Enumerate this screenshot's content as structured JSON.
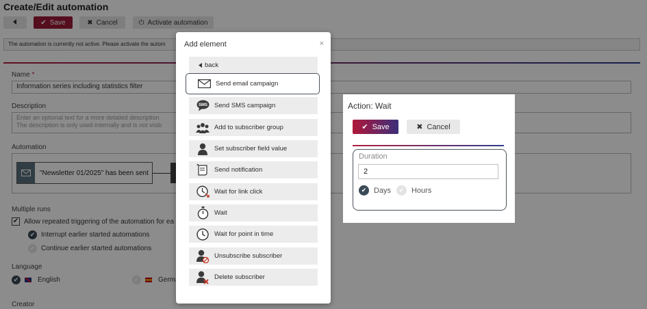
{
  "page": {
    "title": "Create/Edit automation",
    "toolbar": {
      "back_icon": "caret-left",
      "save_label": "Save",
      "cancel_label": "Cancel",
      "activate_label": "Activate automation"
    },
    "info_text": "The automation is currently not active. Please activate the autom",
    "name": {
      "label": "Name",
      "required_mark": "*",
      "value": "Information series including statistics filter"
    },
    "description": {
      "label": "Description",
      "placeholder_line1": "Enter an optional text for a more detailed description",
      "placeholder_line2": "The description is only used internally and is not visib"
    },
    "automation": {
      "label": "Automation",
      "trigger_text": "\"Newsletter 01/2025\" has been sent"
    },
    "multiple_runs": {
      "label": "Multiple runs",
      "allow_label": "Allow repeated triggering of the automation for ea",
      "interrupt_label": "Interrupt earlier started automations",
      "continue_label": "Continue earlier started automations"
    },
    "language": {
      "label": "Language",
      "english": "English",
      "german": "German"
    },
    "creator_label": "Creator"
  },
  "modal": {
    "title": "Add element",
    "close": "×",
    "items": [
      {
        "label": "back",
        "icon": "caret-left-icon"
      },
      {
        "label": "Send email campaign",
        "icon": "envelope-icon"
      },
      {
        "label": "Send SMS campaign",
        "icon": "sms-icon"
      },
      {
        "label": "Add to subscriber group",
        "icon": "group-icon"
      },
      {
        "label": "Set subscriber field value",
        "icon": "user-icon"
      },
      {
        "label": "Send notification",
        "icon": "notification-icon"
      },
      {
        "label": "Wait for link click",
        "icon": "clock-link-icon"
      },
      {
        "label": "Wait",
        "icon": "stopwatch-icon"
      },
      {
        "label": "Wait for point in time",
        "icon": "clock-icon"
      },
      {
        "label": "Unsubscribe subscriber",
        "icon": "user-unsubscribe-icon"
      },
      {
        "label": "Delete subscriber",
        "icon": "user-delete-icon"
      }
    ],
    "sms_text": "SMS"
  },
  "action_panel": {
    "title": "Action: Wait",
    "save_label": "Save",
    "cancel_label": "Cancel",
    "duration_label": "Duration",
    "duration_value": "2",
    "unit_days": "Days",
    "unit_hours": "Hours",
    "selected_unit": "Days"
  },
  "colors": {
    "save_red": "#9b1b36",
    "accent_blue": "#2d3a8c",
    "selected_border": "#48515a"
  }
}
